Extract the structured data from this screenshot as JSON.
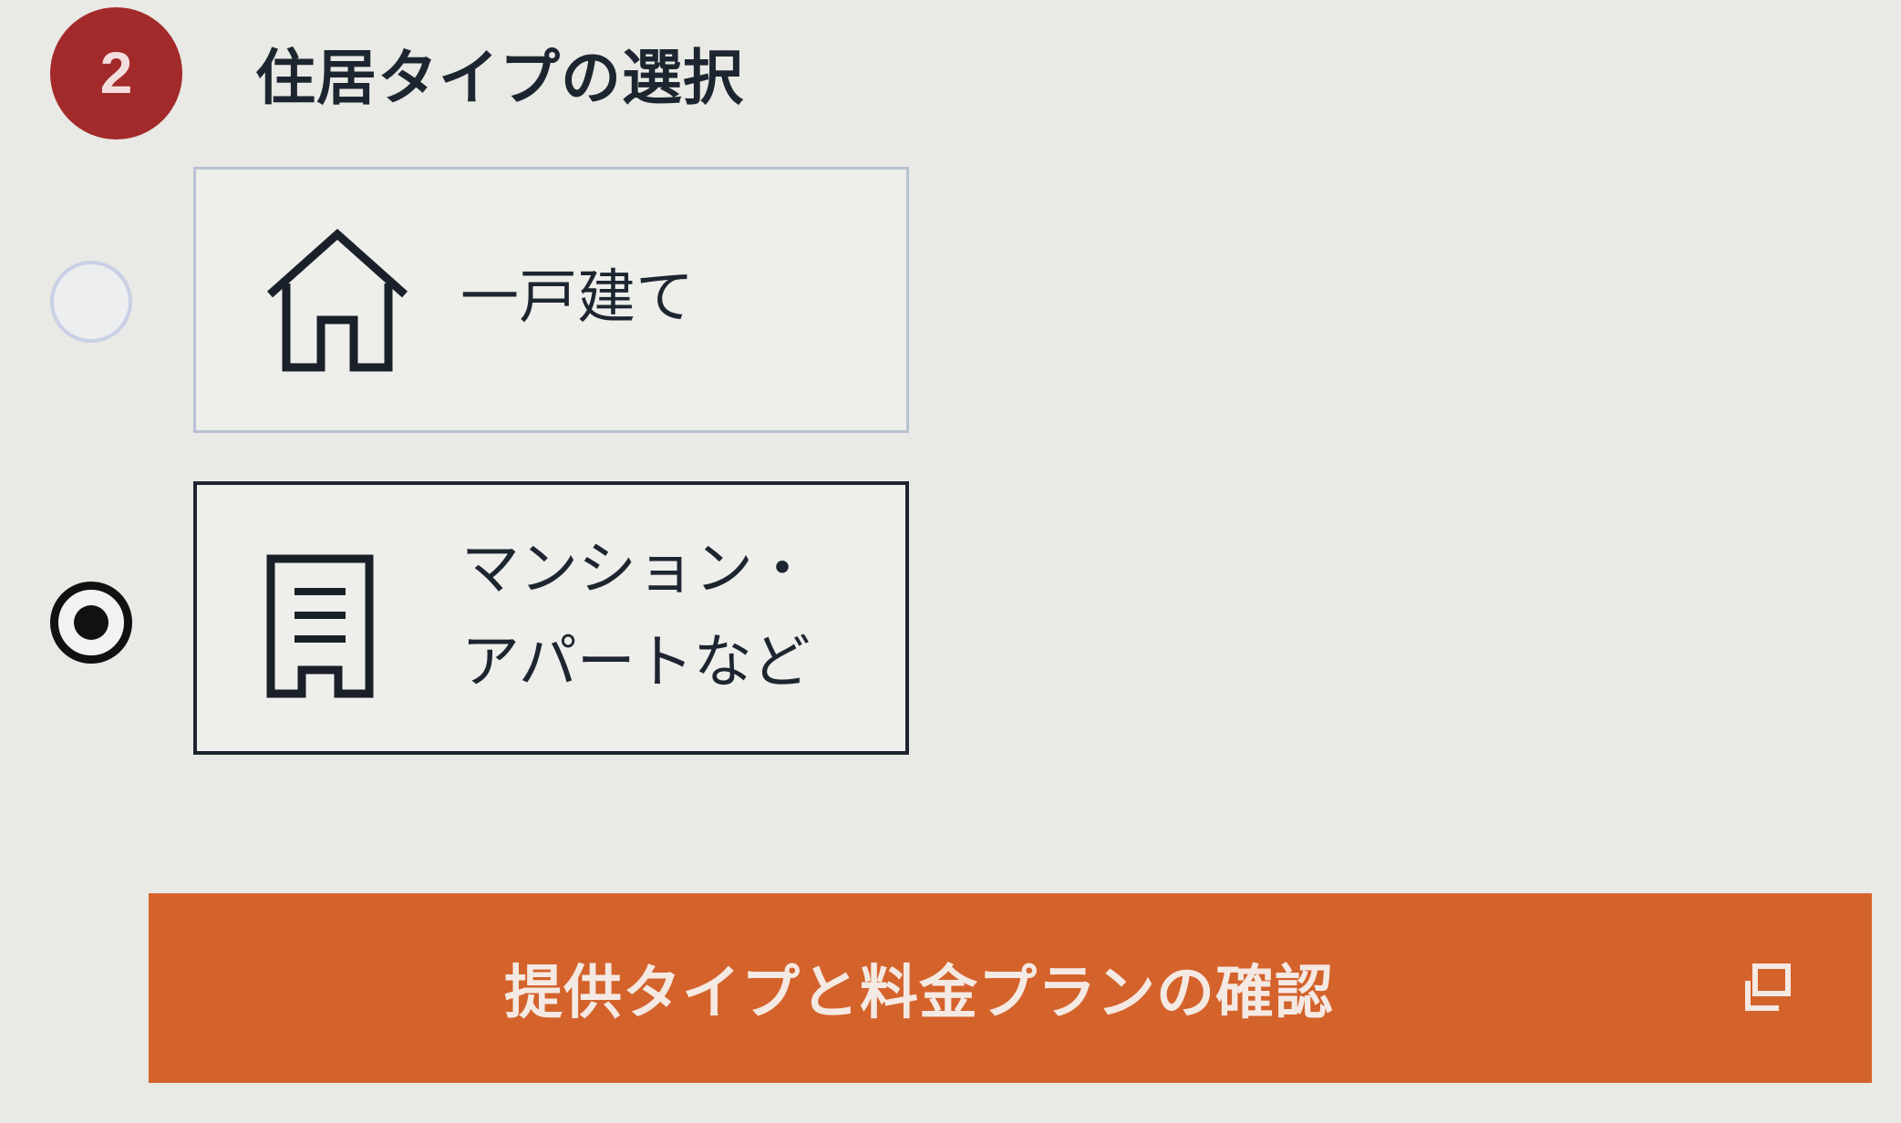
{
  "step": {
    "number": "2",
    "title": "住居タイプの選択"
  },
  "options": [
    {
      "label": "一戸建て",
      "icon": "house-icon",
      "selected": false
    },
    {
      "label_line1": "マンション・",
      "label_line2": "アパートなど",
      "icon": "apartment-building-icon",
      "selected": true
    }
  ],
  "submit": {
    "label": "提供タイプと料金プランの確認",
    "icon": "external-window-icon"
  },
  "colors": {
    "badge": "#a32a2a",
    "button": "#d4622b",
    "background": "#e9e9e5",
    "text": "#1d2630"
  }
}
